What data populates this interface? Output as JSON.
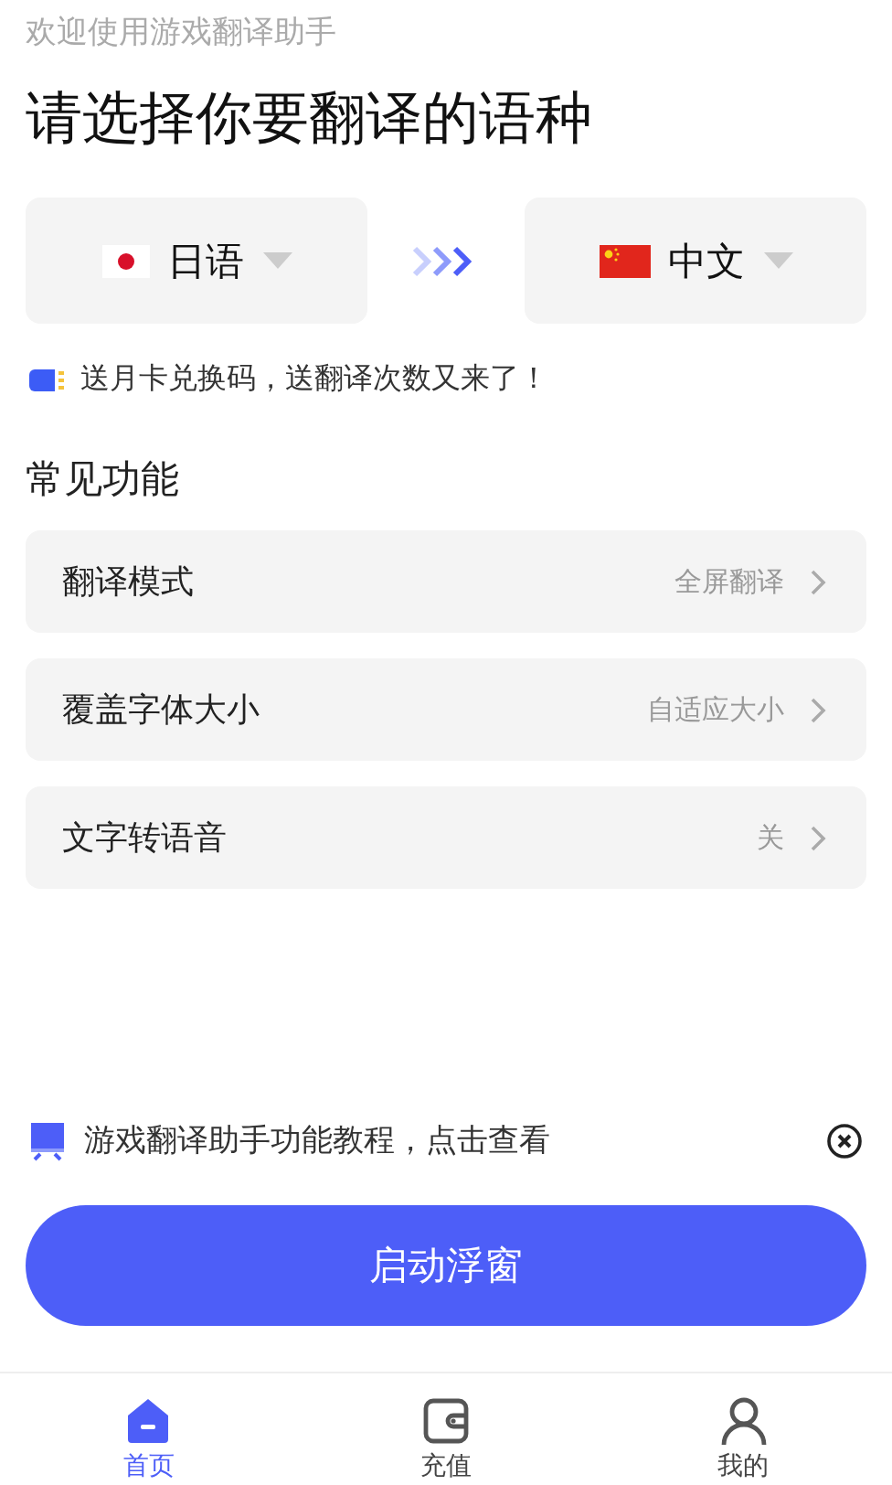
{
  "welcome": "欢迎使用游戏翻译助手",
  "title": "请选择你要翻译的语种",
  "languages": [
    {
      "label": "日语",
      "kind": "japan"
    },
    {
      "label": "中文",
      "kind": "china"
    }
  ],
  "promo": "送月卡兑换码，送翻译次数又来了！",
  "section_title": "常见功能",
  "settings": [
    {
      "label": "翻译模式",
      "value": "全屏翻译"
    },
    {
      "label": "覆盖字体大小",
      "value": "自适应大小"
    },
    {
      "label": "文字转语音",
      "value": "关"
    }
  ],
  "tutorial": "游戏翻译助手功能教程，点击查看",
  "start_button": "启动浮窗",
  "nav": [
    {
      "label": "首页",
      "selected": true
    },
    {
      "label": "充值",
      "selected": false
    },
    {
      "label": "我的",
      "selected": false
    }
  ]
}
